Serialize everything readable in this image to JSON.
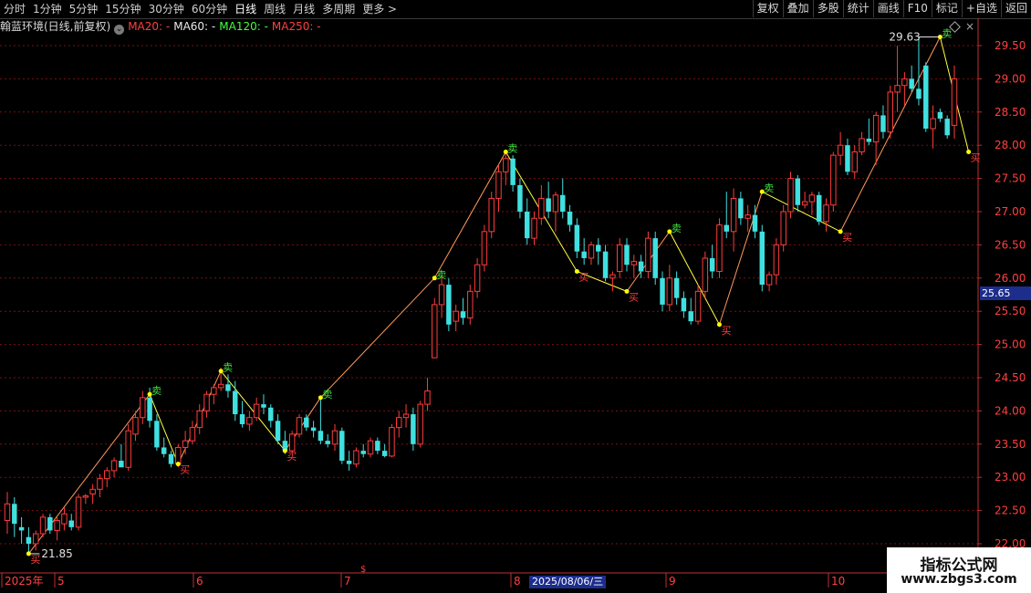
{
  "toolbar": {
    "periods": [
      "分时",
      "1分钟",
      "5分钟",
      "15分钟",
      "30分钟",
      "60分钟",
      "日线",
      "周线",
      "月线",
      "多周期",
      "更多 >"
    ],
    "active_period": "日线",
    "tools": [
      "复权",
      "叠加",
      "多股",
      "统计",
      "画线",
      "F10",
      "标记",
      "+自选",
      "返回"
    ]
  },
  "info": {
    "stock": "翰蓝环境(日线,前复权)",
    "ma20": "MA20: -",
    "ma60": "MA60: -",
    "ma120": "MA120: -",
    "ma250": "MA250: -",
    "ma_colors": {
      "ma20": "#ff4040",
      "ma60": "#e8e8e8",
      "ma120": "#40ff40",
      "ma250": "#ff4040"
    }
  },
  "colors": {
    "up": "#ff3c3c",
    "down": "#40e0e0",
    "grid": "#7a1010",
    "axis": "#c03030",
    "zigzag_up": "#ff9a5a",
    "zigzag_down": "#ffff40",
    "sell_label": "#40e040",
    "buy_label": "#ff3c3c"
  },
  "price_axis": {
    "labels": [
      "29.50",
      "29.00",
      "28.50",
      "28.00",
      "27.50",
      "27.00",
      "26.50",
      "26.00",
      "25.50",
      "25.00",
      "24.50",
      "24.00",
      "23.50",
      "23.00",
      "22.50",
      "22.00"
    ],
    "current_price": "25.65"
  },
  "date_axis": {
    "labels": [
      "2025年",
      "5",
      "6",
      "7",
      "8",
      "9",
      "10"
    ],
    "cursor_date": "2025/08/06/三"
  },
  "annotations": {
    "high": "29.63",
    "low": "21.85",
    "sell_label": "卖",
    "buy_label": "买"
  },
  "watermark": {
    "line1": "指标公式网",
    "line2": "www.zbgs3.com"
  },
  "chart_data": {
    "type": "candlestick",
    "ylim": [
      21.8,
      29.9
    ],
    "candles": [
      {
        "o": 22.35,
        "h": 22.78,
        "l": 22.15,
        "c": 22.6
      },
      {
        "o": 22.6,
        "h": 22.7,
        "l": 22.1,
        "c": 22.3
      },
      {
        "o": 22.25,
        "h": 22.4,
        "l": 22.0,
        "c": 22.2
      },
      {
        "o": 22.1,
        "h": 22.25,
        "l": 21.85,
        "c": 22.0
      },
      {
        "o": 22.0,
        "h": 22.2,
        "l": 21.9,
        "c": 22.15
      },
      {
        "o": 22.15,
        "h": 22.45,
        "l": 22.1,
        "c": 22.4
      },
      {
        "o": 22.4,
        "h": 22.45,
        "l": 22.15,
        "c": 22.2
      },
      {
        "o": 22.2,
        "h": 22.4,
        "l": 22.05,
        "c": 22.35
      },
      {
        "o": 22.3,
        "h": 22.55,
        "l": 22.2,
        "c": 22.45
      },
      {
        "o": 22.35,
        "h": 22.45,
        "l": 22.2,
        "c": 22.25
      },
      {
        "o": 22.25,
        "h": 22.75,
        "l": 22.2,
        "c": 22.7
      },
      {
        "o": 22.7,
        "h": 22.75,
        "l": 22.6,
        "c": 22.72
      },
      {
        "o": 22.75,
        "h": 22.9,
        "l": 22.6,
        "c": 22.82
      },
      {
        "o": 22.82,
        "h": 23.05,
        "l": 22.7,
        "c": 22.98
      },
      {
        "o": 22.98,
        "h": 23.15,
        "l": 22.85,
        "c": 23.1
      },
      {
        "o": 23.1,
        "h": 23.3,
        "l": 23.0,
        "c": 23.25
      },
      {
        "o": 23.25,
        "h": 23.5,
        "l": 23.2,
        "c": 23.15
      },
      {
        "o": 23.15,
        "h": 23.8,
        "l": 23.1,
        "c": 23.7
      },
      {
        "o": 23.65,
        "h": 24.0,
        "l": 23.55,
        "c": 23.9
      },
      {
        "o": 23.9,
        "h": 24.3,
        "l": 23.8,
        "c": 24.2
      },
      {
        "o": 24.2,
        "h": 24.35,
        "l": 23.75,
        "c": 23.85
      },
      {
        "o": 23.85,
        "h": 23.95,
        "l": 23.4,
        "c": 23.45
      },
      {
        "o": 23.45,
        "h": 23.6,
        "l": 23.3,
        "c": 23.35
      },
      {
        "o": 23.35,
        "h": 23.4,
        "l": 23.15,
        "c": 23.2
      },
      {
        "o": 23.2,
        "h": 23.5,
        "l": 23.15,
        "c": 23.45
      },
      {
        "o": 23.45,
        "h": 23.7,
        "l": 23.35,
        "c": 23.55
      },
      {
        "o": 23.55,
        "h": 23.85,
        "l": 23.5,
        "c": 23.75
      },
      {
        "o": 23.75,
        "h": 24.1,
        "l": 23.65,
        "c": 24.0
      },
      {
        "o": 24.0,
        "h": 24.3,
        "l": 23.9,
        "c": 24.25
      },
      {
        "o": 24.25,
        "h": 24.4,
        "l": 24.1,
        "c": 24.35
      },
      {
        "o": 24.35,
        "h": 24.65,
        "l": 24.3,
        "c": 24.4
      },
      {
        "o": 24.4,
        "h": 24.55,
        "l": 24.2,
        "c": 24.3
      },
      {
        "o": 24.3,
        "h": 24.45,
        "l": 23.85,
        "c": 23.95
      },
      {
        "o": 23.95,
        "h": 24.15,
        "l": 23.75,
        "c": 23.8
      },
      {
        "o": 23.8,
        "h": 24.0,
        "l": 23.7,
        "c": 23.9
      },
      {
        "o": 23.9,
        "h": 24.2,
        "l": 23.85,
        "c": 24.1
      },
      {
        "o": 24.1,
        "h": 24.25,
        "l": 23.95,
        "c": 24.05
      },
      {
        "o": 24.05,
        "h": 24.1,
        "l": 23.75,
        "c": 23.85
      },
      {
        "o": 23.85,
        "h": 23.95,
        "l": 23.5,
        "c": 23.55
      },
      {
        "o": 23.55,
        "h": 23.7,
        "l": 23.35,
        "c": 23.4
      },
      {
        "o": 23.4,
        "h": 23.7,
        "l": 23.35,
        "c": 23.65
      },
      {
        "o": 23.65,
        "h": 23.95,
        "l": 23.6,
        "c": 23.9
      },
      {
        "o": 23.9,
        "h": 23.95,
        "l": 23.7,
        "c": 23.75
      },
      {
        "o": 23.75,
        "h": 23.85,
        "l": 23.6,
        "c": 23.7
      },
      {
        "o": 23.7,
        "h": 24.2,
        "l": 23.5,
        "c": 23.55
      },
      {
        "o": 23.55,
        "h": 23.65,
        "l": 23.45,
        "c": 23.5
      },
      {
        "o": 23.5,
        "h": 23.8,
        "l": 23.4,
        "c": 23.7
      },
      {
        "o": 23.7,
        "h": 23.75,
        "l": 23.2,
        "c": 23.25
      },
      {
        "o": 23.25,
        "h": 23.4,
        "l": 23.1,
        "c": 23.2
      },
      {
        "o": 23.2,
        "h": 23.45,
        "l": 23.15,
        "c": 23.4
      },
      {
        "o": 23.4,
        "h": 23.5,
        "l": 23.3,
        "c": 23.35
      },
      {
        "o": 23.35,
        "h": 23.6,
        "l": 23.3,
        "c": 23.55
      },
      {
        "o": 23.55,
        "h": 23.6,
        "l": 23.35,
        "c": 23.4
      },
      {
        "o": 23.4,
        "h": 23.5,
        "l": 23.3,
        "c": 23.32
      },
      {
        "o": 23.32,
        "h": 23.8,
        "l": 23.3,
        "c": 23.75
      },
      {
        "o": 23.75,
        "h": 24.0,
        "l": 23.6,
        "c": 23.9
      },
      {
        "o": 23.9,
        "h": 24.1,
        "l": 23.75,
        "c": 23.95
      },
      {
        "o": 23.95,
        "h": 24.05,
        "l": 23.4,
        "c": 23.5
      },
      {
        "o": 23.5,
        "h": 24.15,
        "l": 23.45,
        "c": 24.1
      },
      {
        "o": 24.1,
        "h": 24.5,
        "l": 24.0,
        "c": 24.3
      },
      {
        "o": 24.8,
        "h": 25.7,
        "l": 24.8,
        "c": 25.6
      },
      {
        "o": 25.6,
        "h": 26.05,
        "l": 25.4,
        "c": 25.9
      },
      {
        "o": 25.9,
        "h": 26.0,
        "l": 25.2,
        "c": 25.3
      },
      {
        "o": 25.35,
        "h": 25.6,
        "l": 25.2,
        "c": 25.5
      },
      {
        "o": 25.5,
        "h": 25.7,
        "l": 25.3,
        "c": 25.4
      },
      {
        "o": 25.4,
        "h": 25.9,
        "l": 25.3,
        "c": 25.8
      },
      {
        "o": 25.8,
        "h": 26.3,
        "l": 25.7,
        "c": 26.2
      },
      {
        "o": 26.2,
        "h": 26.8,
        "l": 26.1,
        "c": 26.7
      },
      {
        "o": 26.7,
        "h": 27.3,
        "l": 26.6,
        "c": 27.2
      },
      {
        "o": 27.2,
        "h": 27.7,
        "l": 27.0,
        "c": 27.6
      },
      {
        "o": 27.6,
        "h": 27.9,
        "l": 27.4,
        "c": 27.8
      },
      {
        "o": 27.8,
        "h": 27.85,
        "l": 27.3,
        "c": 27.4
      },
      {
        "o": 27.4,
        "h": 27.5,
        "l": 26.9,
        "c": 27.0
      },
      {
        "o": 27.0,
        "h": 27.2,
        "l": 26.5,
        "c": 26.6
      },
      {
        "o": 26.6,
        "h": 27.0,
        "l": 26.5,
        "c": 26.9
      },
      {
        "o": 26.9,
        "h": 27.4,
        "l": 26.8,
        "c": 27.2
      },
      {
        "o": 27.2,
        "h": 27.45,
        "l": 26.9,
        "c": 27.0
      },
      {
        "o": 27.0,
        "h": 27.3,
        "l": 26.7,
        "c": 27.25
      },
      {
        "o": 27.25,
        "h": 27.5,
        "l": 26.9,
        "c": 27.0
      },
      {
        "o": 27.0,
        "h": 27.1,
        "l": 26.7,
        "c": 26.8
      },
      {
        "o": 26.8,
        "h": 26.9,
        "l": 26.3,
        "c": 26.4
      },
      {
        "o": 26.4,
        "h": 26.6,
        "l": 26.2,
        "c": 26.3
      },
      {
        "o": 26.3,
        "h": 26.55,
        "l": 26.2,
        "c": 26.5
      },
      {
        "o": 26.5,
        "h": 26.6,
        "l": 26.2,
        "c": 26.4
      },
      {
        "o": 26.4,
        "h": 26.5,
        "l": 25.95,
        "c": 26.0
      },
      {
        "o": 26.0,
        "h": 26.1,
        "l": 25.8,
        "c": 26.05
      },
      {
        "o": 26.1,
        "h": 26.6,
        "l": 26.0,
        "c": 26.5
      },
      {
        "o": 26.5,
        "h": 26.6,
        "l": 26.1,
        "c": 26.2
      },
      {
        "o": 26.2,
        "h": 26.35,
        "l": 26.0,
        "c": 26.25
      },
      {
        "o": 26.25,
        "h": 26.35,
        "l": 26.0,
        "c": 26.1
      },
      {
        "o": 26.1,
        "h": 26.7,
        "l": 26.0,
        "c": 26.6
      },
      {
        "o": 26.6,
        "h": 26.7,
        "l": 25.9,
        "c": 26.0
      },
      {
        "o": 26.0,
        "h": 26.1,
        "l": 25.5,
        "c": 25.6
      },
      {
        "o": 25.6,
        "h": 26.2,
        "l": 25.5,
        "c": 26.0
      },
      {
        "o": 26.0,
        "h": 26.1,
        "l": 25.6,
        "c": 25.7
      },
      {
        "o": 25.7,
        "h": 25.8,
        "l": 25.4,
        "c": 25.5
      },
      {
        "o": 25.5,
        "h": 25.7,
        "l": 25.3,
        "c": 25.35
      },
      {
        "o": 25.35,
        "h": 25.9,
        "l": 25.3,
        "c": 25.8
      },
      {
        "o": 25.8,
        "h": 26.4,
        "l": 25.7,
        "c": 26.3
      },
      {
        "o": 26.3,
        "h": 26.5,
        "l": 26.0,
        "c": 26.1
      },
      {
        "o": 26.1,
        "h": 26.9,
        "l": 26.0,
        "c": 26.8
      },
      {
        "o": 26.8,
        "h": 27.3,
        "l": 26.6,
        "c": 26.7
      },
      {
        "o": 26.7,
        "h": 27.35,
        "l": 26.4,
        "c": 27.2
      },
      {
        "o": 27.2,
        "h": 27.3,
        "l": 26.8,
        "c": 26.9
      },
      {
        "o": 26.9,
        "h": 27.1,
        "l": 26.7,
        "c": 26.95
      },
      {
        "o": 26.95,
        "h": 27.1,
        "l": 26.6,
        "c": 26.7
      },
      {
        "o": 26.7,
        "h": 26.8,
        "l": 25.8,
        "c": 25.9
      },
      {
        "o": 25.9,
        "h": 26.1,
        "l": 25.8,
        "c": 26.05
      },
      {
        "o": 26.05,
        "h": 26.6,
        "l": 25.9,
        "c": 26.5
      },
      {
        "o": 26.5,
        "h": 27.1,
        "l": 26.4,
        "c": 27.0
      },
      {
        "o": 27.0,
        "h": 27.6,
        "l": 26.9,
        "c": 27.5
      },
      {
        "o": 27.5,
        "h": 27.55,
        "l": 27.0,
        "c": 27.1
      },
      {
        "o": 27.1,
        "h": 27.3,
        "l": 27.05,
        "c": 27.15
      },
      {
        "o": 27.15,
        "h": 27.3,
        "l": 26.95,
        "c": 27.25
      },
      {
        "o": 27.25,
        "h": 27.3,
        "l": 26.8,
        "c": 26.85
      },
      {
        "o": 26.85,
        "h": 27.2,
        "l": 26.7,
        "c": 27.1
      },
      {
        "o": 27.1,
        "h": 27.9,
        "l": 27.0,
        "c": 27.85
      },
      {
        "o": 27.85,
        "h": 28.2,
        "l": 27.7,
        "c": 28.0
      },
      {
        "o": 28.0,
        "h": 28.1,
        "l": 27.55,
        "c": 27.6
      },
      {
        "o": 27.6,
        "h": 28.0,
        "l": 27.5,
        "c": 27.9
      },
      {
        "o": 27.9,
        "h": 28.2,
        "l": 27.85,
        "c": 28.1
      },
      {
        "o": 28.1,
        "h": 28.4,
        "l": 28.0,
        "c": 28.05
      },
      {
        "o": 28.05,
        "h": 28.5,
        "l": 27.7,
        "c": 28.45
      },
      {
        "o": 28.45,
        "h": 28.6,
        "l": 28.1,
        "c": 28.2
      },
      {
        "o": 28.2,
        "h": 28.9,
        "l": 28.1,
        "c": 28.8
      },
      {
        "o": 28.8,
        "h": 29.5,
        "l": 28.5,
        "c": 28.9
      },
      {
        "o": 28.9,
        "h": 29.1,
        "l": 28.6,
        "c": 29.0
      },
      {
        "o": 29.0,
        "h": 29.2,
        "l": 28.8,
        "c": 28.85
      },
      {
        "o": 28.85,
        "h": 29.63,
        "l": 28.6,
        "c": 28.7
      },
      {
        "o": 29.2,
        "h": 29.25,
        "l": 28.2,
        "c": 28.25
      },
      {
        "o": 28.25,
        "h": 28.6,
        "l": 27.95,
        "c": 28.4
      },
      {
        "o": 28.5,
        "h": 28.55,
        "l": 28.35,
        "c": 28.4
      },
      {
        "o": 28.4,
        "h": 28.45,
        "l": 28.1,
        "c": 28.15
      },
      {
        "o": 28.3,
        "h": 29.2,
        "l": 28.1,
        "c": 29.0
      }
    ],
    "zigzag": [
      {
        "i": 3,
        "price": 21.85,
        "type": "buy"
      },
      {
        "i": 20,
        "price": 24.25,
        "type": "sell"
      },
      {
        "i": 24,
        "price": 23.2,
        "type": "buy"
      },
      {
        "i": 30,
        "price": 24.6,
        "type": "sell"
      },
      {
        "i": 39,
        "price": 23.4,
        "type": "buy"
      },
      {
        "i": 44,
        "price": 24.2,
        "type": "sell"
      },
      {
        "i": 60,
        "price": 26.0,
        "type": "sell"
      },
      {
        "i": 70,
        "price": 27.9,
        "type": "sell"
      },
      {
        "i": 80,
        "price": 26.1,
        "type": "buy"
      },
      {
        "i": 87,
        "price": 25.8,
        "type": "buy"
      },
      {
        "i": 93,
        "price": 26.7,
        "type": "sell"
      },
      {
        "i": 100,
        "price": 25.3,
        "type": "buy"
      },
      {
        "i": 106,
        "price": 27.3,
        "type": "sell"
      },
      {
        "i": 117,
        "price": 26.7,
        "type": "buy"
      },
      {
        "i": 131,
        "price": 29.63,
        "type": "sell"
      },
      {
        "i": 135,
        "price": 27.9,
        "type": "buy"
      }
    ]
  }
}
